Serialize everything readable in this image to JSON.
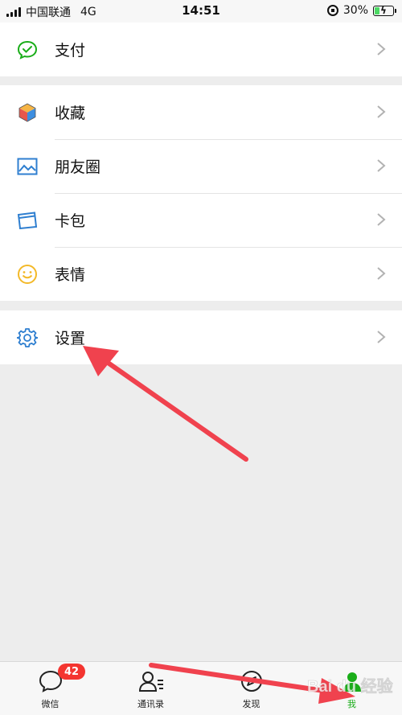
{
  "status_bar": {
    "carrier": "中国联通",
    "network": "4G",
    "time": "14:51",
    "battery": "30%",
    "battery_level": 0.3
  },
  "menu": {
    "pay": "支付",
    "favorites": "收藏",
    "moments": "朋友圈",
    "cards": "卡包",
    "stickers": "表情",
    "settings": "设置"
  },
  "tabbar": {
    "items": [
      {
        "label": "微信",
        "badge": "42"
      },
      {
        "label": "通讯录"
      },
      {
        "label": "发现"
      },
      {
        "label": "我"
      }
    ],
    "active_color": "#1aad19"
  },
  "watermark": "Bai du 经验",
  "annotation_color": "#f0424e"
}
